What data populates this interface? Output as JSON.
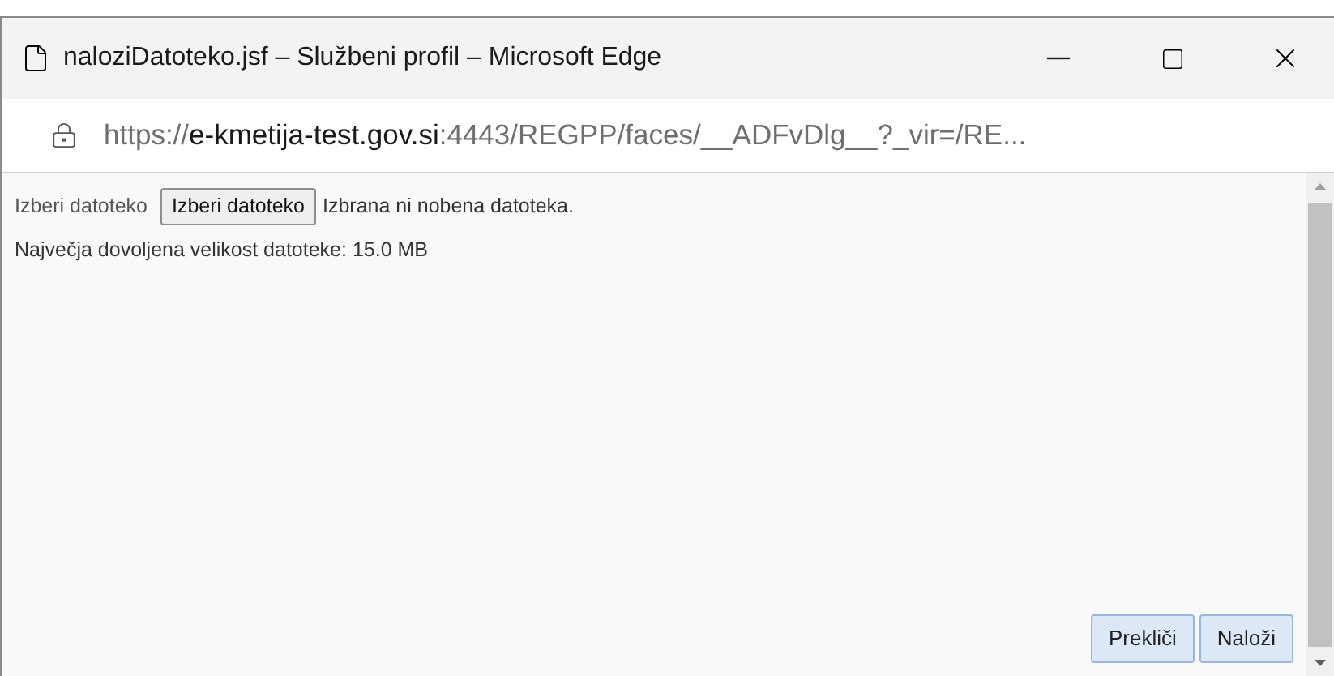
{
  "window": {
    "title": "naloziDatoteko.jsf – Službeni profil – Microsoft Edge"
  },
  "address_bar": {
    "scheme": "https://",
    "host": "e-kmetija-test.gov.si",
    "rest": ":4443/REGPP/faces/__ADFvDlg__?_vir=/RE..."
  },
  "form": {
    "file_label": "Izberi datoteko",
    "file_button": "Izberi datoteko",
    "file_status": "Izbrana ni nobena datoteka.",
    "max_size_note": "Največja dovoljena velikost datoteke: 15.0 MB"
  },
  "buttons": [
    "Prekliči",
    "Naloži"
  ]
}
